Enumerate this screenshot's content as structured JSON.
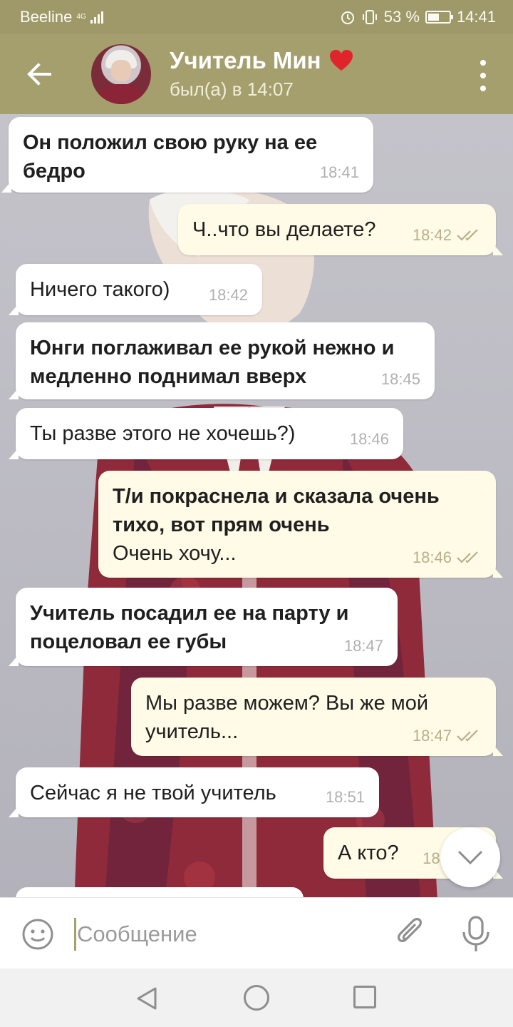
{
  "status_bar": {
    "carrier": "Beeline",
    "network": "4G",
    "battery": "53 %",
    "battery_level": 0.53,
    "time": "14:41"
  },
  "header": {
    "contact_name": "Учитель Мин",
    "last_seen": "был(а) в 14:07",
    "accent_color": "#a59f6e"
  },
  "messages": [
    {
      "dir": "in",
      "bold": "Он положил свою руку на ее бедро",
      "text": "",
      "time": "18:41"
    },
    {
      "dir": "out",
      "bold": "",
      "text": "Ч..что вы делаете?",
      "time": "18:42",
      "read": true
    },
    {
      "dir": "in",
      "bold": "",
      "text": "Ничего такого)",
      "time": "18:42"
    },
    {
      "dir": "in",
      "bold": "Юнги поглаживал ее рукой нежно и медленно поднимал вверх",
      "text": "",
      "time": "18:45"
    },
    {
      "dir": "in",
      "bold": "",
      "text": "Ты разве этого не хочешь?)",
      "time": "18:46"
    },
    {
      "dir": "out",
      "bold": "Т/и покраснела и сказала очень тихо, вот прям очень",
      "text": "Очень хочу...",
      "time": "18:46",
      "read": true
    },
    {
      "dir": "in",
      "bold": "Учитель посадил ее на парту и поцеловал ее губы",
      "text": "",
      "time": "18:47"
    },
    {
      "dir": "out",
      "bold": "",
      "text": "Мы разве можем? Вы же мой учитель...",
      "time": "18:47",
      "read": true
    },
    {
      "dir": "in",
      "bold": "",
      "text": "Сейчас я не твой учитель",
      "time": "18:51"
    },
    {
      "dir": "out",
      "bold": "",
      "text": "А кто?",
      "time": "18:5",
      "read": true
    }
  ],
  "input": {
    "placeholder": "Сообщение"
  },
  "icons": {
    "back": "back-arrow-icon",
    "menu": "more-vert-icon",
    "emoji": "emoji-icon",
    "attach": "paperclip-icon",
    "mic": "microphone-icon",
    "scroll": "chevron-down-icon"
  }
}
